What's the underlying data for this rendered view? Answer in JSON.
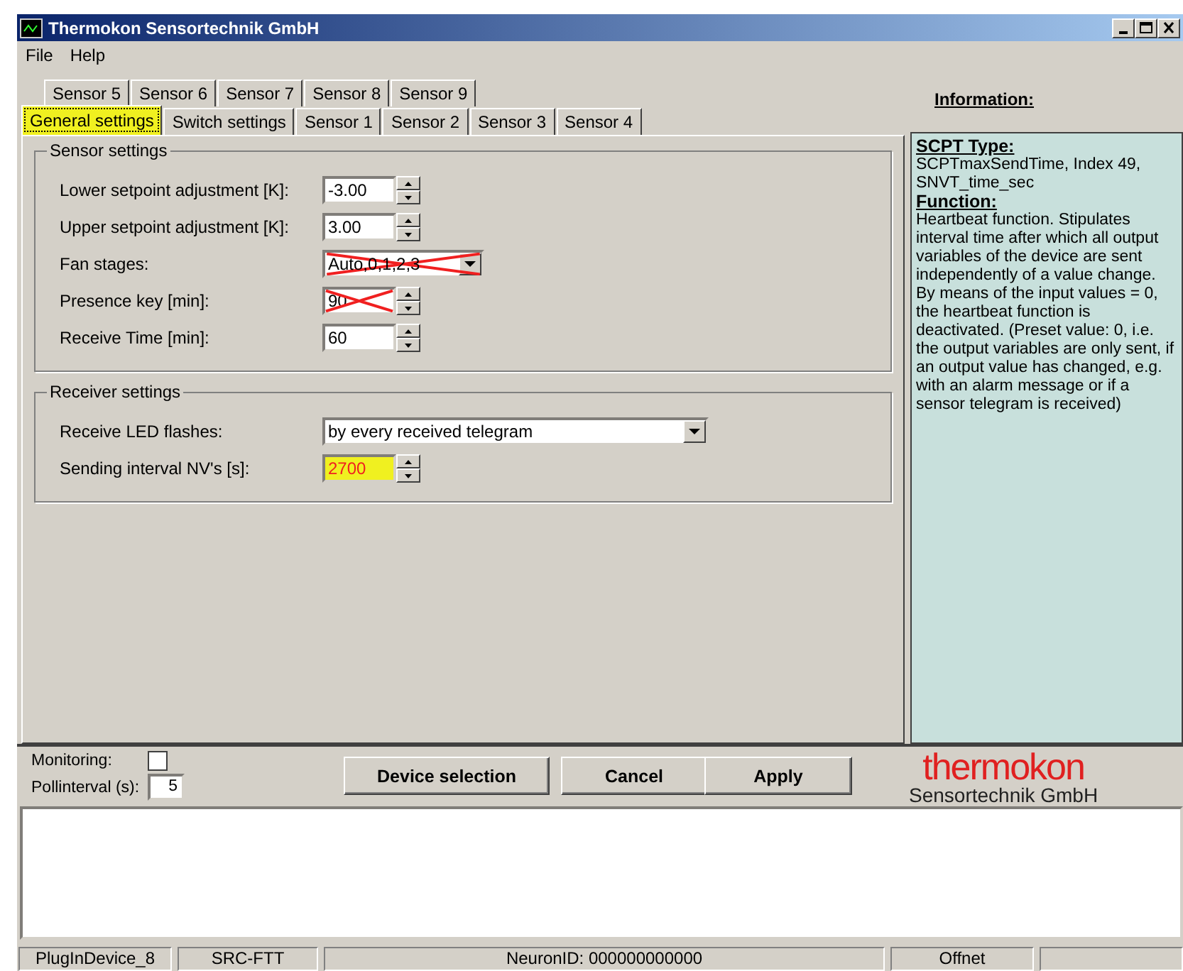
{
  "window": {
    "title": "Thermokon Sensortechnik GmbH"
  },
  "menu": [
    "File",
    "Help"
  ],
  "tab_rows": [
    [
      {
        "label": "Sensor 5",
        "selected": false
      },
      {
        "label": "Sensor 6",
        "selected": false
      },
      {
        "label": "Sensor 7",
        "selected": false
      },
      {
        "label": "Sensor 8",
        "selected": false
      },
      {
        "label": "Sensor 9",
        "selected": false
      }
    ],
    [
      {
        "label": "General settings",
        "selected": true
      },
      {
        "label": "Switch settings",
        "selected": false
      },
      {
        "label": "Sensor 1",
        "selected": false
      },
      {
        "label": "Sensor 2",
        "selected": false
      },
      {
        "label": "Sensor 3",
        "selected": false
      },
      {
        "label": "Sensor 4",
        "selected": false
      }
    ]
  ],
  "groups": [
    {
      "title": "Sensor settings",
      "fields": [
        {
          "kind": "spin",
          "label": "Lower setpoint adjustment [K]:",
          "value": "-3.00",
          "disabled": false,
          "highlighted": false
        },
        {
          "kind": "spin",
          "label": "Upper setpoint adjustment [K]:",
          "value": "3.00",
          "disabled": false,
          "highlighted": false
        },
        {
          "kind": "combo",
          "label": "Fan stages:",
          "value": "Auto,0,1,2,3",
          "disabled": true,
          "highlighted": false
        },
        {
          "kind": "spin",
          "label": "Presence key [min]:",
          "value": "90",
          "disabled": true,
          "highlighted": false
        },
        {
          "kind": "spin",
          "label": "Receive Time [min]:",
          "value": "60",
          "disabled": false,
          "highlighted": false
        }
      ]
    },
    {
      "title": "Receiver settings",
      "fields": [
        {
          "kind": "wide-combo",
          "label": "Receive LED flashes:",
          "value": "by every received telegram",
          "disabled": false,
          "highlighted": false
        },
        {
          "kind": "spin",
          "label": "Sending interval NV's [s]:",
          "value": "2700",
          "disabled": false,
          "highlighted": true
        }
      ]
    }
  ],
  "information": {
    "title": "Information:",
    "sections": [
      {
        "heading": "SCPT Type:",
        "text": "SCPTmaxSendTime, Index 49, SNVT_time_sec"
      },
      {
        "heading": "Function:",
        "text": "Heartbeat function. Stipulates interval time after which all output variables of the device are sent independently of a value change. By means of the input values = 0, the heartbeat function is deactivated. (Preset value: 0, i.e. the output variables are only sent, if an output value has changed, e.g. with an alarm message or if a sensor telegram is received)"
      }
    ]
  },
  "monitoring": {
    "label": "Monitoring:",
    "checked": false
  },
  "pollinterval": {
    "label": "Pollinterval (s):",
    "value": "5"
  },
  "buttons": [
    "Device selection",
    "Cancel",
    "Apply"
  ],
  "logo": {
    "brand": "thermokon",
    "subtitle": "Sensortechnik GmbH"
  },
  "status_bar": [
    "PlugInDevice_8",
    "SRC-FTT",
    "NeuronID:  000000000000",
    "Offnet"
  ]
}
